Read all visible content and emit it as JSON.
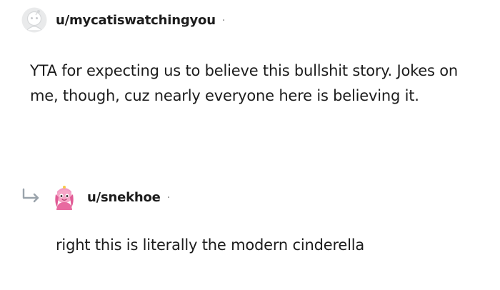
{
  "comments": [
    {
      "username": "u/mycatiswatchingyou",
      "separator": "·",
      "text": "YTA for expecting us to believe this bullshit story. Jokes on me, though, cuz nearly everyone here is believing it.",
      "avatar_icon": "default-avatar-icon"
    },
    {
      "username": "u/snekhoe",
      "separator": "·",
      "text": "right this is literally the modern cinderella",
      "avatar_icon": "pink-character-avatar-icon",
      "reply_icon": "reply-arrow-icon"
    }
  ],
  "colors": {
    "text": "#1c1c1c",
    "muted": "#7c7c7c",
    "avatar_pink": "#e86aa0"
  }
}
